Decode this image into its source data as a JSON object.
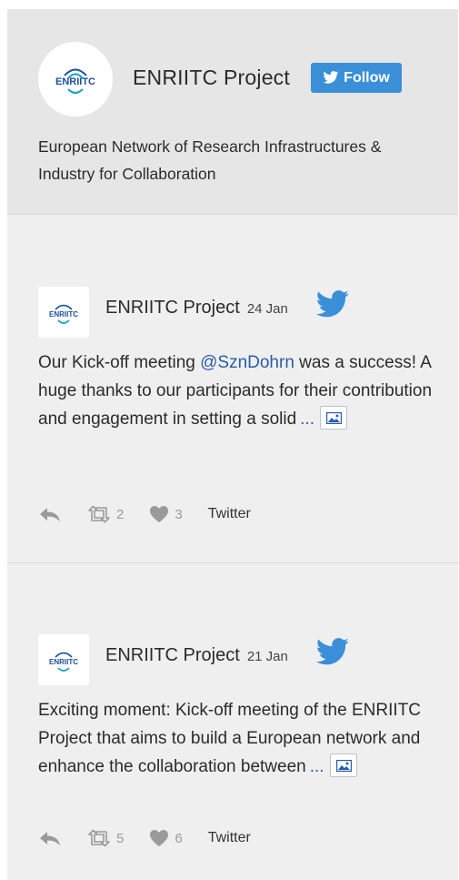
{
  "profile": {
    "name": "ENRIITC Project",
    "follow_label": "Follow",
    "description": "European Network of Research Infrastructures & Industry for Collaboration",
    "logo_text": "ENRIITC"
  },
  "tweets": [
    {
      "author": "ENRIITC Project",
      "date": "24 Jan",
      "text_before": "Our Kick-off meeting ",
      "mention": "@SznDohrn",
      "text_after": " was a success! A huge thanks to our participants for their contribution and engagement in setting a solid",
      "more": "...",
      "retweets": "2",
      "likes": "3",
      "source": "Twitter"
    },
    {
      "author": "ENRIITC Project",
      "date": "21 Jan",
      "text_before": "Exciting moment: Kick-off meeting of the ENRIITC Project that aims to build a European network and enhance the collaboration between",
      "more": "...",
      "retweets": "5",
      "likes": "6",
      "source": "Twitter"
    }
  ],
  "colors": {
    "follow_button": "#3a8fd8",
    "twitter_bird": "#3a8fd8",
    "link": "#2a5da6",
    "logo_blue": "#1c4f9c",
    "logo_teal": "#1aa3b8"
  },
  "icons": [
    "twitter-bird-icon",
    "reply-icon",
    "retweet-icon",
    "heart-icon",
    "image-icon"
  ]
}
